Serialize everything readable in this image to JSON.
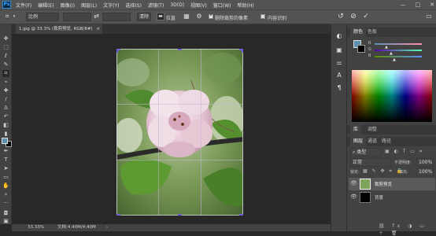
{
  "app": {
    "logo": "Ps"
  },
  "menu": [
    "文件(F)",
    "编辑(E)",
    "图像(I)",
    "图层(L)",
    "文字(Y)",
    "选择(S)",
    "滤镜(T)",
    "3D(D)",
    "视图(V)",
    "窗口(W)",
    "帮助(H)"
  ],
  "window_controls": {
    "minimize": "—",
    "maximize": "□",
    "close": "✕"
  },
  "options": {
    "ratio_value": "比例",
    "clear_label": "清除",
    "straighten_label": "拉直",
    "delete_cropped_label": "删除裁剪的像素",
    "delete_cropped_checked": true,
    "content_aware_label": "内容识别",
    "content_aware_checked": false
  },
  "document": {
    "tab_title": "1.jpg @ 33.3% (裁剪预览, RGB/8#)",
    "close": "×"
  },
  "status": {
    "zoom": "33.33%",
    "doc_info": "文档:4.40M/4.40M"
  },
  "color_panel": {
    "tabs": [
      "颜色",
      "色板"
    ],
    "channels": [
      "R",
      "G",
      "B"
    ]
  },
  "lib_panel": {
    "tabs": [
      "库",
      "调整"
    ]
  },
  "layers_panel": {
    "tabs": [
      "图层",
      "通道",
      "路径"
    ],
    "filter_kind": "类型",
    "blend_mode": "正常",
    "opacity_label": "不透明度:",
    "opacity_value": "100%",
    "lock_label": "锁定:",
    "fill_label": "填充:",
    "fill_value": "100%",
    "layers": [
      {
        "name": "裁剪预览",
        "selected": true
      },
      {
        "name": "背景",
        "selected": false
      }
    ]
  }
}
